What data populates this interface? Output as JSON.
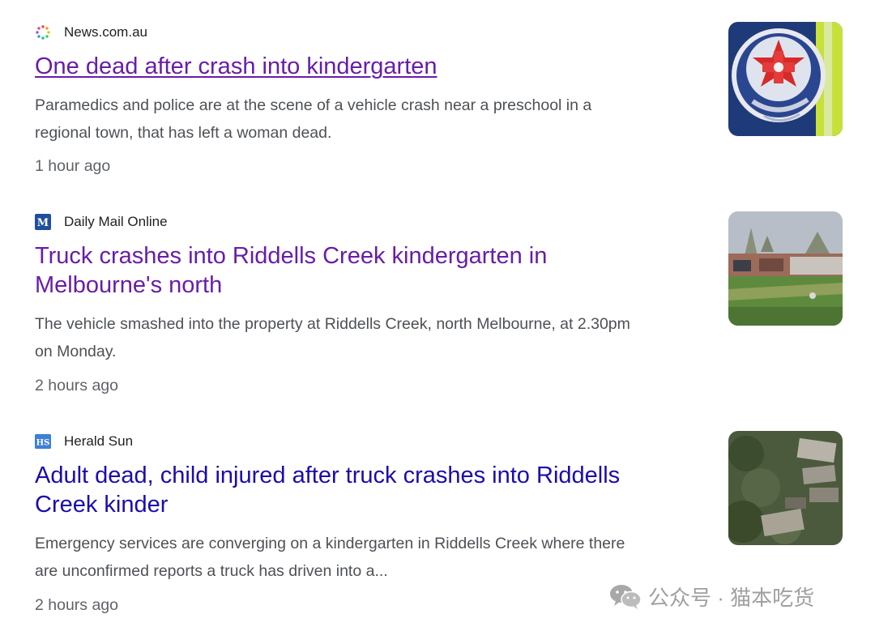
{
  "results": [
    {
      "source": "News.com.au",
      "source_icon": "newscomau-logo-icon",
      "headline": "One dead after crash into kindergarten",
      "snippet_lines": [
        "Paramedics and police are at the scene of a vehicle crash near a preschool in a",
        "regional town, that has left a woman dead."
      ],
      "time": "1 hour ago",
      "thumbnail": "ambulance-victoria-badge-image"
    },
    {
      "source": "Daily Mail Online",
      "source_icon": "daily-mail-logo-icon",
      "source_icon_text": "M",
      "headline_lines": [
        "Truck crashes into Riddells Creek kindergarten in",
        "Melbourne's north"
      ],
      "snippet_lines": [
        "The vehicle smashed into the property at Riddells Creek, north Melbourne, at 2.30pm",
        "on Monday."
      ],
      "time": "2 hours ago",
      "thumbnail": "kindergarten-building-image"
    },
    {
      "source": "Herald Sun",
      "source_icon": "herald-sun-logo-icon",
      "source_icon_text": "HS",
      "headline_lines": [
        "Adult dead, child injured after truck crashes into Riddells",
        "Creek kinder"
      ],
      "snippet_lines": [
        "Emergency services are converging on a kindergarten in Riddells Creek where there",
        "are unconfirmed reports a truck has driven into a..."
      ],
      "time": "2 hours ago",
      "thumbnail": "aerial-view-image"
    }
  ],
  "watermark": {
    "icon": "wechat-icon",
    "text": "公众号 · 猫本吃货"
  },
  "colors": {
    "visited_link": "#681da8",
    "link": "#1a0dab",
    "snippet": "#4d5156",
    "time": "#5f6368",
    "daily_mail_blue": "#1f4e9c",
    "herald_sun_blue": "#3d7fd8"
  }
}
